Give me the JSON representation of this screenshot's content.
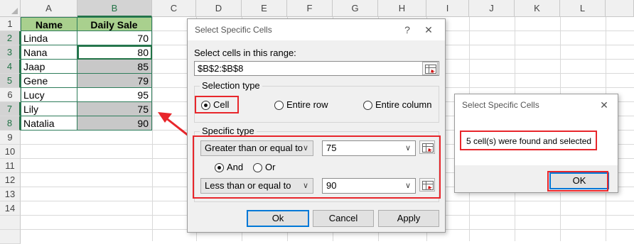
{
  "spreadsheet": {
    "columns": [
      "A",
      "B",
      "C",
      "D",
      "E",
      "F",
      "G",
      "H",
      "I",
      "J",
      "K",
      "L"
    ],
    "rows": [
      "1",
      "2",
      "3",
      "4",
      "5",
      "6",
      "7",
      "8",
      "9",
      "10",
      "11",
      "12",
      "13",
      "14"
    ],
    "table": {
      "header": [
        "Name",
        "Daily Sale"
      ],
      "rows": [
        {
          "name": "Linda",
          "sale": "70",
          "selected": false
        },
        {
          "name": "Nana",
          "sale": "80",
          "selected": true
        },
        {
          "name": "Jaap",
          "sale": "85",
          "selected": true
        },
        {
          "name": "Gene",
          "sale": "79",
          "selected": true
        },
        {
          "name": "Lucy",
          "sale": "95",
          "selected": false
        },
        {
          "name": "Lily",
          "sale": "75",
          "selected": true
        },
        {
          "name": "Natalia",
          "sale": "90",
          "selected": true
        }
      ]
    },
    "header_fill": "#a9d08e",
    "selected_fill": "#c8c8c8"
  },
  "main_dialog": {
    "title": "Select Specific Cells",
    "help_icon": "?",
    "close_icon": "✕",
    "range_label": "Select cells in this range:",
    "range_value": "$B$2:$B$8",
    "selection_type_title": "Selection type",
    "selection_types": [
      {
        "label": "Cell",
        "checked": true
      },
      {
        "label": "Entire row",
        "checked": false
      },
      {
        "label": "Entire column",
        "checked": false
      }
    ],
    "specific_type_title": "Specific type",
    "condition1": {
      "operator": "Greater than or equal to",
      "value": "75"
    },
    "logic": [
      {
        "label": "And",
        "checked": true
      },
      {
        "label": "Or",
        "checked": false
      }
    ],
    "condition2": {
      "operator": "Less than or equal to",
      "value": "90"
    },
    "buttons": {
      "ok": "Ok",
      "cancel": "Cancel",
      "apply": "Apply"
    }
  },
  "result_dialog": {
    "title": "Select Specific Cells",
    "close_icon": "✕",
    "message": "5 cell(s) were found and selected",
    "ok": "OK"
  },
  "annotation_color": "#e8262b"
}
